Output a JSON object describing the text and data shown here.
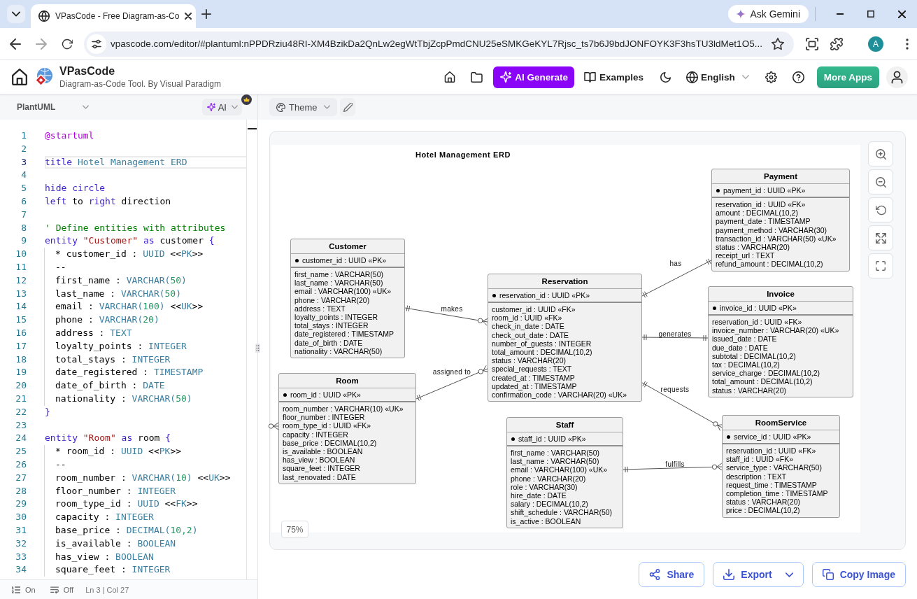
{
  "browser": {
    "tab": {
      "title": "VPasCode - Free Diagram-as-Co"
    },
    "gemini_button": "Ask Gemini",
    "address_bar": {
      "url": "vpascode.com/editor/#plantuml:nPPDRziu48RI-XM4BzikDa2QnLw2egWtTbjZcpPmdCNU25eSMKGeKYL7Rjsc_ts7b6J9bdJONFOYK3F3hsTU3ldMet1O5..."
    },
    "profile": "A"
  },
  "header": {
    "app_name": "VPasCode",
    "tagline": "Diagram-as-Code Tool. By Visual Paradigm",
    "ai_button": "AI Generate",
    "examples": "Examples",
    "language": "English",
    "more_apps": "More Apps"
  },
  "editor": {
    "syntax": "PlantUML",
    "ai_menu": "AI",
    "lines": [
      {
        "number": "1",
        "current": false,
        "in_block": false,
        "tokens": [
          {
            "kind": "directive",
            "text": "@startuml"
          }
        ]
      },
      {
        "number": "2",
        "current": false,
        "in_block": false
      },
      {
        "number": "3",
        "current": true,
        "in_block": false,
        "tokens": [
          {
            "kind": "keyword",
            "text": "title "
          },
          {
            "kind": "literal",
            "text": "Hotel Management ERD"
          }
        ]
      },
      {
        "number": "4",
        "current": false,
        "in_block": false
      },
      {
        "number": "5",
        "current": false,
        "in_block": false,
        "tokens": [
          {
            "kind": "keyword",
            "text": "hide circle"
          }
        ]
      },
      {
        "number": "6",
        "current": false,
        "in_block": false,
        "tokens": [
          {
            "kind": "keyword",
            "text": "left"
          },
          {
            "kind": "plain",
            "text": " to "
          },
          {
            "kind": "keyword",
            "text": "right"
          },
          {
            "kind": "plain",
            "text": " direction"
          }
        ]
      },
      {
        "number": "7",
        "current": false,
        "in_block": false
      },
      {
        "number": "8",
        "current": false,
        "in_block": false,
        "tokens": [
          {
            "kind": "comment",
            "text": "' Define entities with attributes"
          }
        ]
      },
      {
        "number": "9",
        "current": false,
        "in_block": false,
        "tokens": [
          {
            "kind": "keyword",
            "text": "entity "
          },
          {
            "kind": "string",
            "text": "\"Customer\""
          },
          {
            "kind": "keyword",
            "text": " as"
          },
          {
            "kind": "plain",
            "text": " customer "
          },
          {
            "kind": "keyword",
            "text": "{"
          }
        ]
      },
      {
        "number": "10",
        "current": false,
        "in_block": true,
        "tokens": [
          {
            "kind": "plain",
            "text": "* customer_id : "
          },
          {
            "kind": "type",
            "text": "UUID"
          },
          {
            "kind": "plain",
            "text": " <<"
          },
          {
            "kind": "type",
            "text": "PK"
          },
          {
            "kind": "plain",
            "text": ">>"
          }
        ]
      },
      {
        "number": "11",
        "current": false,
        "in_block": true,
        "tokens": [
          {
            "kind": "plain",
            "text": "--"
          }
        ]
      },
      {
        "number": "12",
        "current": false,
        "in_block": true,
        "tokens": [
          {
            "kind": "plain",
            "text": "first_name : "
          },
          {
            "kind": "type",
            "text": "VARCHAR("
          },
          {
            "kind": "number",
            "text": "50"
          },
          {
            "kind": "type",
            "text": ")"
          }
        ]
      },
      {
        "number": "13",
        "current": false,
        "in_block": true,
        "tokens": [
          {
            "kind": "plain",
            "text": "last_name : "
          },
          {
            "kind": "type",
            "text": "VARCHAR("
          },
          {
            "kind": "number",
            "text": "50"
          },
          {
            "kind": "type",
            "text": ")"
          }
        ]
      },
      {
        "number": "14",
        "current": false,
        "in_block": true,
        "tokens": [
          {
            "kind": "plain",
            "text": "email : "
          },
          {
            "kind": "type",
            "text": "VARCHAR("
          },
          {
            "kind": "number",
            "text": "100"
          },
          {
            "kind": "type",
            "text": ")"
          },
          {
            "kind": "plain",
            "text": " <<"
          },
          {
            "kind": "type",
            "text": "UK"
          },
          {
            "kind": "plain",
            "text": ">>"
          }
        ]
      },
      {
        "number": "15",
        "current": false,
        "in_block": true,
        "tokens": [
          {
            "kind": "plain",
            "text": "phone : "
          },
          {
            "kind": "type",
            "text": "VARCHAR("
          },
          {
            "kind": "number",
            "text": "20"
          },
          {
            "kind": "type",
            "text": ")"
          }
        ]
      },
      {
        "number": "16",
        "current": false,
        "in_block": true,
        "tokens": [
          {
            "kind": "plain",
            "text": "address : "
          },
          {
            "kind": "type",
            "text": "TEXT"
          }
        ]
      },
      {
        "number": "17",
        "current": false,
        "in_block": true,
        "tokens": [
          {
            "kind": "plain",
            "text": "loyalty_points : "
          },
          {
            "kind": "type",
            "text": "INTEGER"
          }
        ]
      },
      {
        "number": "18",
        "current": false,
        "in_block": true,
        "tokens": [
          {
            "kind": "plain",
            "text": "total_stays : "
          },
          {
            "kind": "type",
            "text": "INTEGER"
          }
        ]
      },
      {
        "number": "19",
        "current": false,
        "in_block": true,
        "tokens": [
          {
            "kind": "plain",
            "text": "date_registered : "
          },
          {
            "kind": "type",
            "text": "TIMESTAMP"
          }
        ]
      },
      {
        "number": "20",
        "current": false,
        "in_block": true,
        "tokens": [
          {
            "kind": "plain",
            "text": "date_of_birth : "
          },
          {
            "kind": "type",
            "text": "DATE"
          }
        ]
      },
      {
        "number": "21",
        "current": false,
        "in_block": true,
        "tokens": [
          {
            "kind": "plain",
            "text": "nationality : "
          },
          {
            "kind": "type",
            "text": "VARCHAR("
          },
          {
            "kind": "number",
            "text": "50"
          },
          {
            "kind": "type",
            "text": ")"
          }
        ]
      },
      {
        "number": "22",
        "current": false,
        "in_block": false,
        "tokens": [
          {
            "kind": "keyword",
            "text": "}"
          }
        ]
      },
      {
        "number": "23",
        "current": false,
        "in_block": false
      },
      {
        "number": "24",
        "current": false,
        "in_block": false,
        "tokens": [
          {
            "kind": "keyword",
            "text": "entity "
          },
          {
            "kind": "string",
            "text": "\"Room\""
          },
          {
            "kind": "keyword",
            "text": " as"
          },
          {
            "kind": "plain",
            "text": " room "
          },
          {
            "kind": "keyword",
            "text": "{"
          }
        ]
      },
      {
        "number": "25",
        "current": false,
        "in_block": true,
        "tokens": [
          {
            "kind": "plain",
            "text": "* room_id : "
          },
          {
            "kind": "type",
            "text": "UUID"
          },
          {
            "kind": "plain",
            "text": " <<"
          },
          {
            "kind": "type",
            "text": "PK"
          },
          {
            "kind": "plain",
            "text": ">>"
          }
        ]
      },
      {
        "number": "26",
        "current": false,
        "in_block": true,
        "tokens": [
          {
            "kind": "plain",
            "text": "--"
          }
        ]
      },
      {
        "number": "27",
        "current": false,
        "in_block": true,
        "tokens": [
          {
            "kind": "plain",
            "text": "room_number : "
          },
          {
            "kind": "type",
            "text": "VARCHAR("
          },
          {
            "kind": "number",
            "text": "10"
          },
          {
            "kind": "type",
            "text": ")"
          },
          {
            "kind": "plain",
            "text": " <<"
          },
          {
            "kind": "type",
            "text": "UK"
          },
          {
            "kind": "plain",
            "text": ">>"
          }
        ]
      },
      {
        "number": "28",
        "current": false,
        "in_block": true,
        "tokens": [
          {
            "kind": "plain",
            "text": "floor_number : "
          },
          {
            "kind": "type",
            "text": "INTEGER"
          }
        ]
      },
      {
        "number": "29",
        "current": false,
        "in_block": true,
        "tokens": [
          {
            "kind": "plain",
            "text": "room_type_id : "
          },
          {
            "kind": "type",
            "text": "UUID"
          },
          {
            "kind": "plain",
            "text": " <<"
          },
          {
            "kind": "type",
            "text": "FK"
          },
          {
            "kind": "plain",
            "text": ">>"
          }
        ]
      },
      {
        "number": "30",
        "current": false,
        "in_block": true,
        "tokens": [
          {
            "kind": "plain",
            "text": "capacity : "
          },
          {
            "kind": "type",
            "text": "INTEGER"
          }
        ]
      },
      {
        "number": "31",
        "current": false,
        "in_block": true,
        "tokens": [
          {
            "kind": "plain",
            "text": "base_price : "
          },
          {
            "kind": "type",
            "text": "DECIMAL("
          },
          {
            "kind": "number",
            "text": "10,2"
          },
          {
            "kind": "type",
            "text": ")"
          }
        ]
      },
      {
        "number": "32",
        "current": false,
        "in_block": true,
        "tokens": [
          {
            "kind": "plain",
            "text": "is_available : "
          },
          {
            "kind": "type",
            "text": "BOOLEAN"
          }
        ]
      },
      {
        "number": "33",
        "current": false,
        "in_block": true,
        "tokens": [
          {
            "kind": "plain",
            "text": "has_view : "
          },
          {
            "kind": "type",
            "text": "BOOLEAN"
          }
        ]
      },
      {
        "number": "34",
        "current": false,
        "in_block": true,
        "tokens": [
          {
            "kind": "plain",
            "text": "square_feet : "
          },
          {
            "kind": "type",
            "text": "INTEGER"
          }
        ]
      }
    ],
    "status": {
      "line_numbers": "On",
      "word_wrap": "Off",
      "cursor": "Ln 3 | Col 27"
    }
  },
  "preview": {
    "theme_button": "Theme",
    "zoom": "75%",
    "diagram": {
      "title": "Hotel Management ERD",
      "entities": [
        {
          "name": "Customer",
          "primary_key": "customer_id : UUID «PK»",
          "attributes": [
            "first_name : VARCHAR(50)",
            "last_name : VARCHAR(50)",
            "email : VARCHAR(100) «UK»",
            "phone : VARCHAR(20)",
            "address : TEXT",
            "loyalty_points : INTEGER",
            "total_stays : INTEGER",
            "date_registered : TIMESTAMP",
            "date_of_birth : DATE",
            "nationality : VARCHAR(50)"
          ]
        },
        {
          "name": "Room",
          "primary_key": "room_id : UUID «PK»",
          "attributes": [
            "room_number : VARCHAR(10) «UK»",
            "floor_number : INTEGER",
            "room_type_id : UUID «FK»",
            "capacity : INTEGER",
            "base_price : DECIMAL(10,2)",
            "is_available : BOOLEAN",
            "has_view : BOOLEAN",
            "square_feet : INTEGER",
            "last_renovated : DATE"
          ]
        },
        {
          "name": "Reservation",
          "primary_key": "reservation_id : UUID «PK»",
          "attributes": [
            "customer_id : UUID «FK»",
            "room_id : UUID «FK»",
            "check_in_date : DATE",
            "check_out_date : DATE",
            "number_of_guests : INTEGER",
            "total_amount : DECIMAL(10,2)",
            "status : VARCHAR(20)",
            "special_requests : TEXT",
            "created_at : TIMESTAMP",
            "updated_at : TIMESTAMP",
            "confirmation_code : VARCHAR(20) «UK»"
          ]
        },
        {
          "name": "Payment",
          "primary_key": "payment_id : UUID «PK»",
          "attributes": [
            "reservation_id : UUID «FK»",
            "amount : DECIMAL(10,2)",
            "payment_date : TIMESTAMP",
            "payment_method : VARCHAR(30)",
            "transaction_id : VARCHAR(50) «UK»",
            "status : VARCHAR(20)",
            "receipt_url : TEXT",
            "refund_amount : DECIMAL(10,2)"
          ]
        },
        {
          "name": "Invoice",
          "primary_key": "invoice_id : UUID «PK»",
          "attributes": [
            "reservation_id : UUID «FK»",
            "invoice_number : VARCHAR(20) «UK»",
            "issued_date : DATE",
            "due_date : DATE",
            "subtotal : DECIMAL(10,2)",
            "tax : DECIMAL(10,2)",
            "service_charge : DECIMAL(10,2)",
            "total_amount : DECIMAL(10,2)",
            "status : VARCHAR(20)"
          ]
        },
        {
          "name": "Staff",
          "primary_key": "staff_id : UUID «PK»",
          "attributes": [
            "first_name : VARCHAR(50)",
            "last_name : VARCHAR(50)",
            "email : VARCHAR(100) «UK»",
            "phone : VARCHAR(20)",
            "role : VARCHAR(30)",
            "hire_date : DATE",
            "salary : DECIMAL(10,2)",
            "shift_schedule : VARCHAR(50)",
            "is_active : BOOLEAN"
          ]
        },
        {
          "name": "RoomService",
          "primary_key": "service_id : UUID «PK»",
          "attributes": [
            "reservation_id : UUID «FK»",
            "staff_id : UUID «FK»",
            "service_type : VARCHAR(50)",
            "description : TEXT",
            "request_time : TIMESTAMP",
            "completion_time : TIMESTAMP",
            "status : VARCHAR(20)",
            "price : DECIMAL(10,2)"
          ]
        }
      ],
      "relations": [
        {
          "label": "makes",
          "kind": "many"
        },
        {
          "label": "assigned to",
          "kind": "many"
        },
        {
          "label": "has",
          "kind": "single"
        },
        {
          "label": "generates",
          "kind": "single"
        },
        {
          "label": "requests",
          "kind": "many"
        },
        {
          "label": "fulfills",
          "kind": "many"
        },
        {
          "kind": "stub"
        }
      ]
    },
    "actions": [
      {
        "label": "Share",
        "kind": "share"
      },
      {
        "label": "Export",
        "kind": "export"
      },
      {
        "label": "Copy Image",
        "kind": "copy"
      }
    ]
  }
}
